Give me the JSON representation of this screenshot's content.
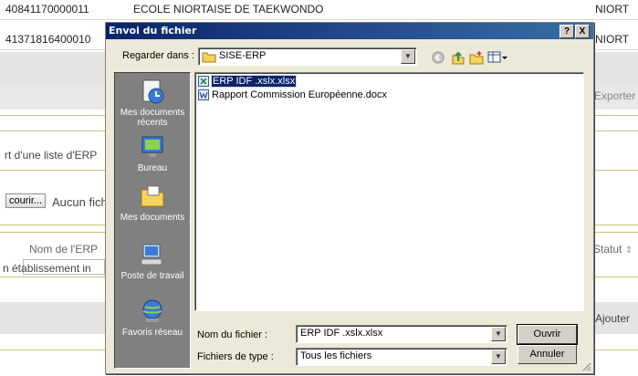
{
  "background": {
    "rows": [
      {
        "code": "40841170000011",
        "name": "ECOLE NIORTAISE DE TAEKWONDO",
        "city": "NIORT"
      },
      {
        "code": "41371816400010",
        "name": "",
        "city": "NIORT"
      }
    ],
    "exporter_link": "Exporter",
    "import_text": "rt d'une liste d'ERP",
    "browse_button": "courir...",
    "no_file_text": "Aucun fich",
    "column_nom": "Nom de l'ERP",
    "column_statut": "Statut",
    "sort_icon": "sort-icon",
    "etab_text": "n établissement in",
    "ajouter_link": "Ajouter"
  },
  "dialog": {
    "title": "Envoi du fichier",
    "help_button": "?",
    "close_button": "X",
    "look_in_label": "Regarder dans :",
    "look_in_value": "SISE-ERP",
    "places": [
      {
        "label": "Mes documents récents",
        "icon": "recent-documents-icon"
      },
      {
        "label": "Bureau",
        "icon": "desktop-icon"
      },
      {
        "label": "Mes documents",
        "icon": "my-documents-icon"
      },
      {
        "label": "Poste de travail",
        "icon": "my-computer-icon"
      },
      {
        "label": "Favoris réseau",
        "icon": "network-places-icon"
      }
    ],
    "files": [
      {
        "name": "ERP IDF .xslx.xlsx",
        "selected": true,
        "icon": "excel-file-icon"
      },
      {
        "name": "Rapport Commission Européenne.docx",
        "selected": false,
        "icon": "word-file-icon"
      }
    ],
    "file_name_label": "Nom du fichier :",
    "file_name_value": "ERP IDF .xslx.xlsx",
    "file_type_label": "Fichiers de type :",
    "file_type_value": "Tous les fichiers",
    "open_button": "Ouvrir",
    "cancel_button": "Annuler"
  },
  "colors": {
    "titlebar": "#0a246a",
    "dialog_face": "#ece9d8",
    "places_bar": "#808080",
    "selection": "#0a246a",
    "accent_line": "#c9c37a"
  }
}
